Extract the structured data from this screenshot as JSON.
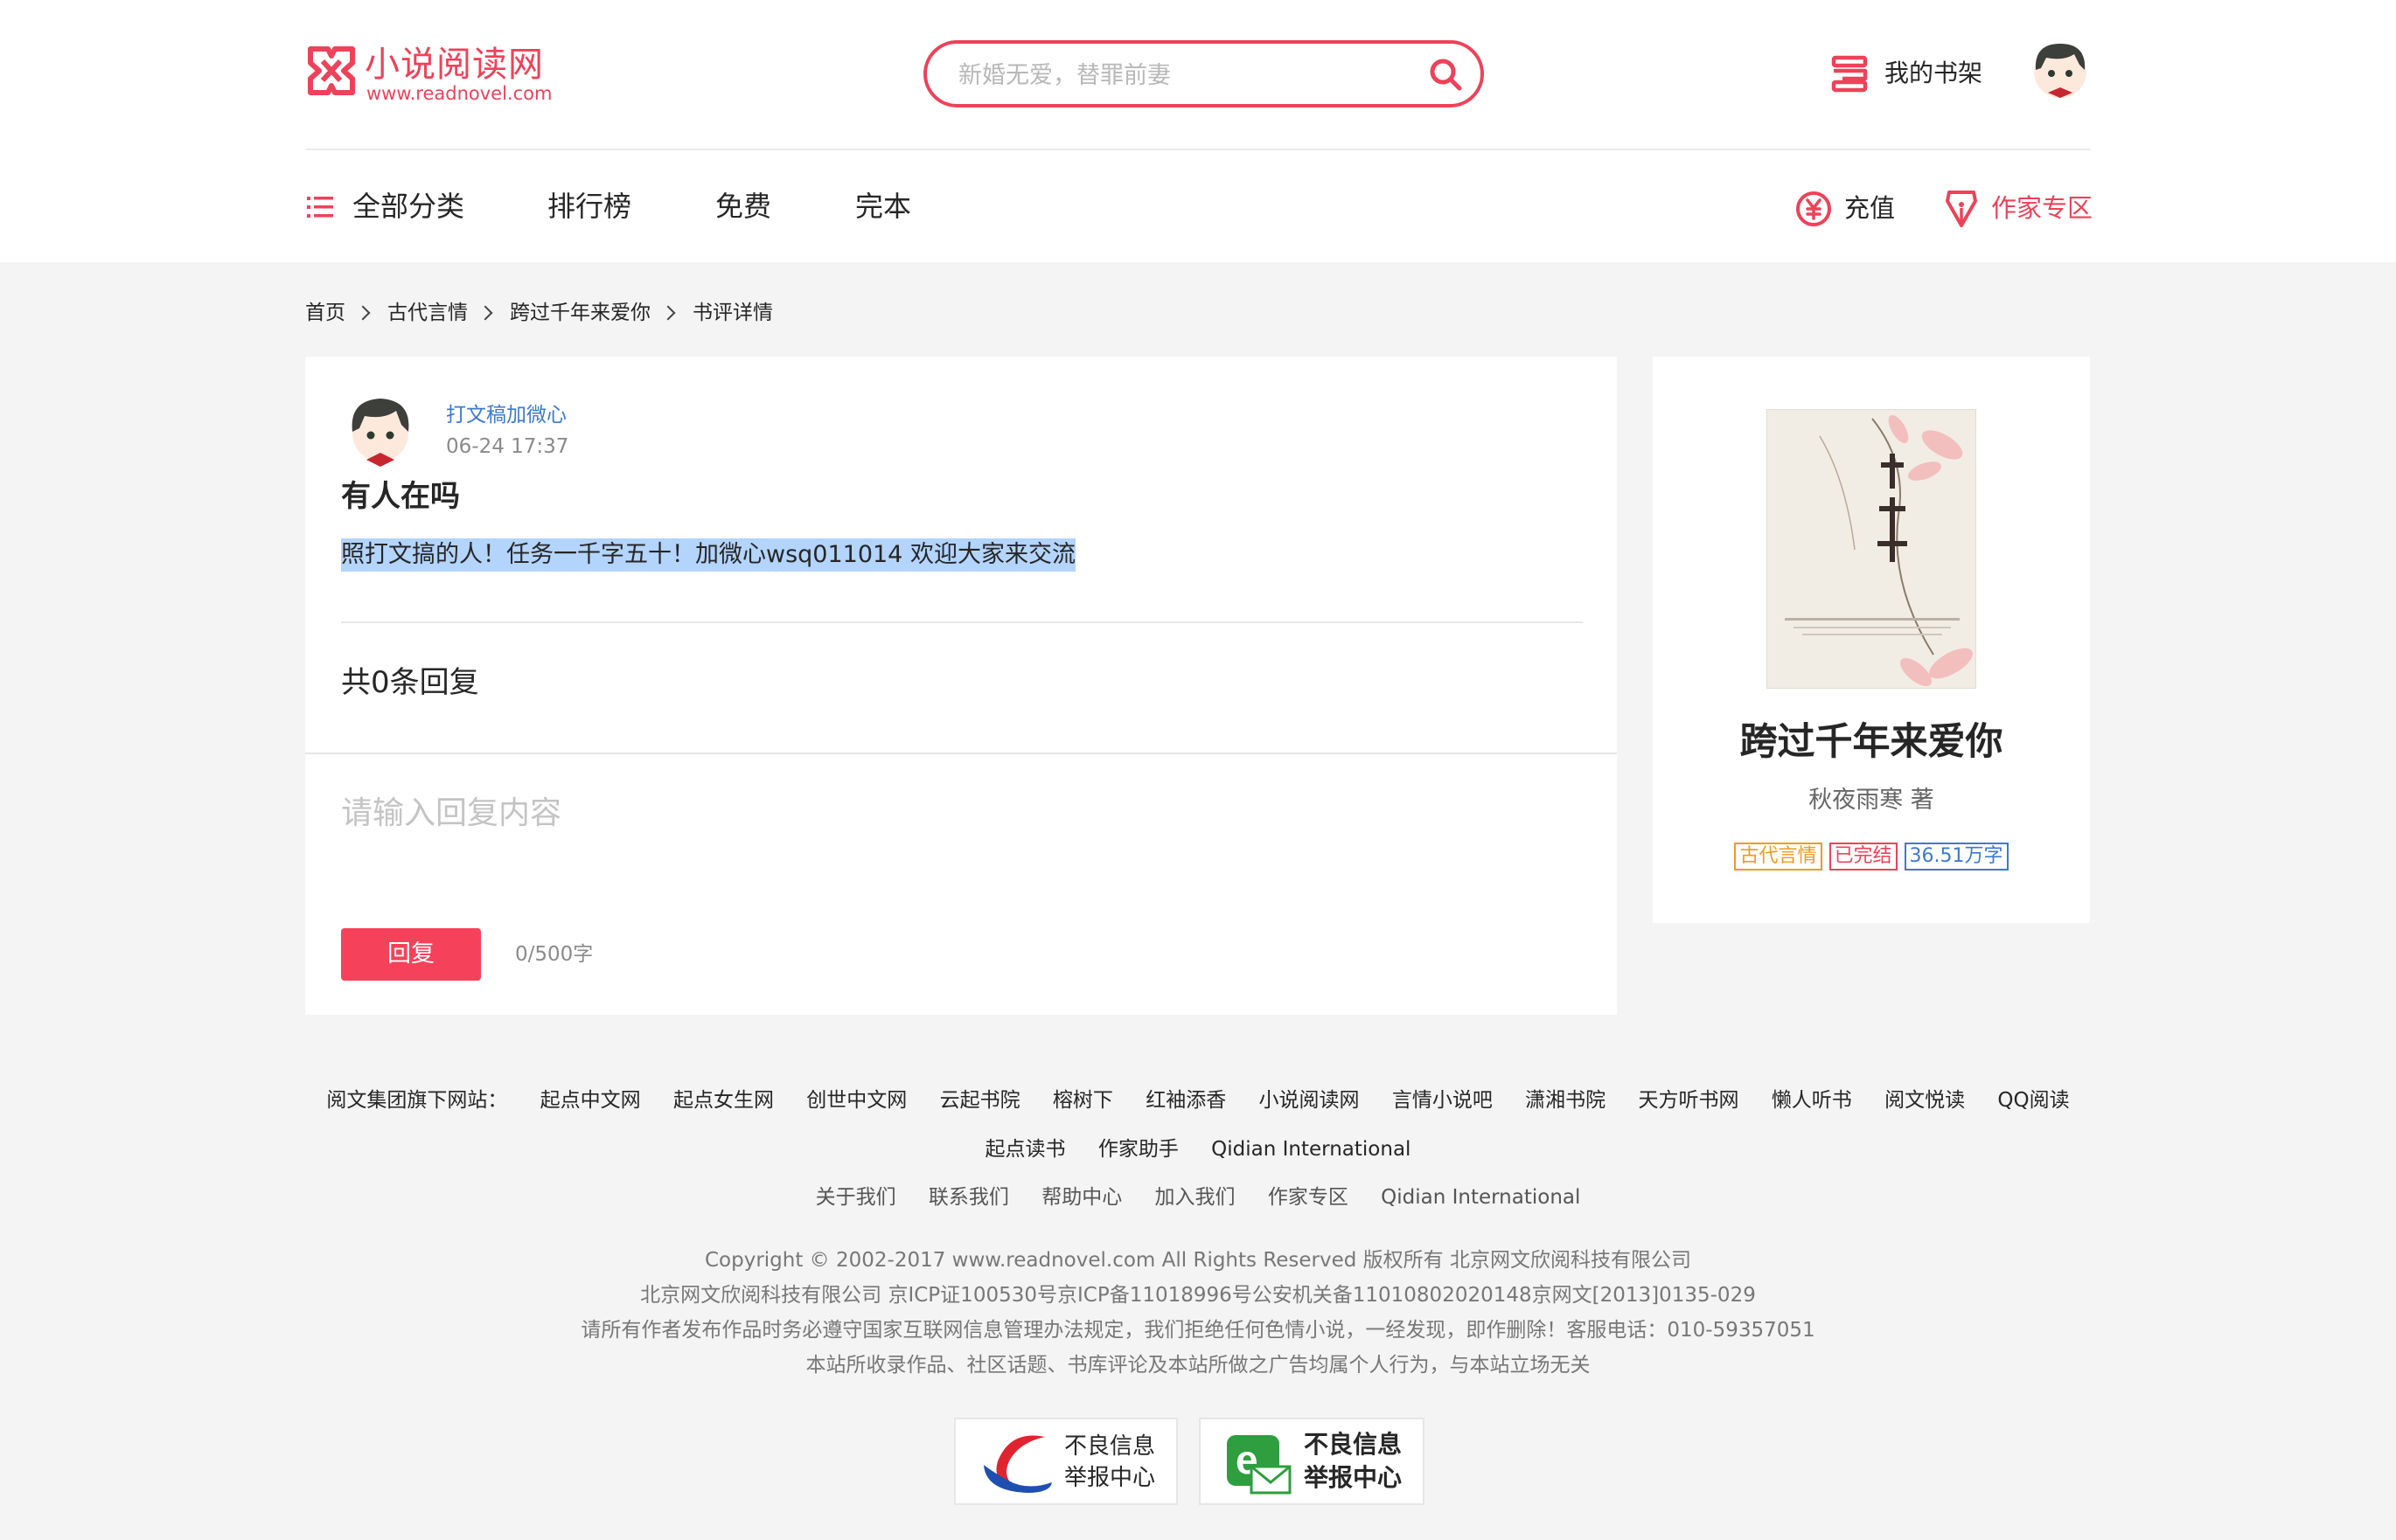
{
  "header": {
    "logo_title": "小说阅读网",
    "logo_url": "www.readnovel.com",
    "search_placeholder": "新婚无爱，替罪前妻",
    "shelf_label": "我的书架"
  },
  "nav": {
    "items": [
      "全部分类",
      "排行榜",
      "免费",
      "完本"
    ],
    "recharge_label": "充值",
    "author_label": "作家专区"
  },
  "breadcrumb": [
    "首页",
    "古代言情",
    "跨过千年来爱你",
    "书评详情"
  ],
  "post": {
    "username": "打文稿加微心",
    "time": "06-24 17:37",
    "title": "有人在吗",
    "body": "照打文搞的人！任务一千字五十！加微心wsq011014 欢迎大家来交流",
    "reply_count": "共0条回复",
    "reply_placeholder": "请输入回复内容",
    "reply_button": "回复",
    "word_count": "0/500字"
  },
  "book": {
    "title": "跨过千年来爱你",
    "author": "秋夜雨寒 著",
    "tags": {
      "category": "古代言情",
      "status": "已完结",
      "words": "36.51万字"
    }
  },
  "footer": {
    "sites_label": "阅文集团旗下网站：",
    "sites": [
      "起点中文网",
      "起点女生网",
      "创世中文网",
      "云起书院",
      "榕树下",
      "红袖添香",
      "小说阅读网",
      "言情小说吧",
      "潇湘书院",
      "天方听书网",
      "懒人听书",
      "阅文悦读",
      "QQ阅读"
    ],
    "sites2": [
      "起点读书",
      "作家助手",
      "Qidian International"
    ],
    "links": [
      "关于我们",
      "联系我们",
      "帮助中心",
      "加入我们",
      "作家专区",
      "Qidian International"
    ],
    "copyright": [
      "Copyright © 2002-2017 www.readnovel.com All Rights Reserved 版权所有 北京网文欣阅科技有限公司",
      "北京网文欣阅科技有限公司 京ICP证100530号京ICP备11018996号公安机关备11010802020148京网文[2013]0135-029",
      "请所有作者发布作品时务必遵守国家互联网信息管理办法规定，我们拒绝任何色情小说，一经发现，即作删除！客服电话：010-59357051",
      "本站所收录作品、社区话题、书库评论及本站所做之广告均属个人行为，与本站立场无关"
    ],
    "badge1": [
      "不良信息",
      "举报中心"
    ],
    "badge2": [
      "不良信息",
      "举报中心"
    ]
  },
  "colors": {
    "brand": "#ed4259",
    "link": "#3b7ad0",
    "tag_orange": "#f09a1e"
  },
  "icons": [
    "logo-mark-icon",
    "search-icon",
    "bookshelf-icon",
    "menu-list-icon",
    "yuan-coin-icon",
    "pen-nib-icon",
    "chevron-right-icon"
  ]
}
